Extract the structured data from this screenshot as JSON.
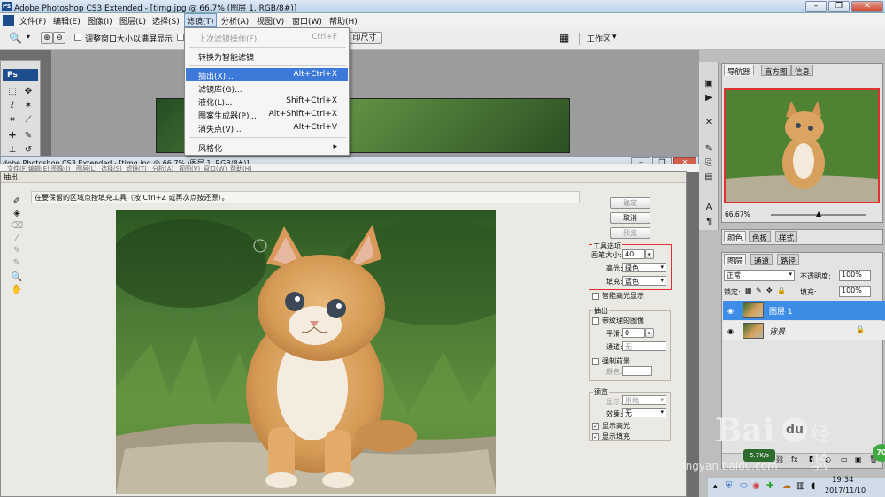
{
  "window": {
    "title": "Adobe Photoshop CS3 Extended - [timg.jpg @ 66.7% (图层 1, RGB/8#)]",
    "ps_badge": "Ps"
  },
  "window_controls": {
    "minimize": "–",
    "restore": "❐",
    "close": "✕"
  },
  "menubar": {
    "items": [
      "文件(F)",
      "编辑(E)",
      "图像(I)",
      "图层(L)",
      "选择(S)",
      "滤镜(T)",
      "分析(A)",
      "视图(V)",
      "窗口(W)",
      "帮助(H)"
    ],
    "active_index": 5
  },
  "options_bar": {
    "resize_window_label": "调整窗口大小以满屏显示",
    "print_size_button": "印尺寸",
    "workspace_label": "工作区"
  },
  "filter_menu": {
    "items": [
      {
        "label": "上次滤镜操作(F)",
        "shortcut": "Ctrl+F",
        "state": "disabled"
      },
      {
        "label": "转换为智能滤镜",
        "shortcut": "",
        "state": "normal"
      },
      {
        "label": "抽出(X)...",
        "shortcut": "Alt+Ctrl+X",
        "state": "highlighted"
      },
      {
        "label": "滤镜库(G)...",
        "shortcut": "",
        "state": "normal"
      },
      {
        "label": "液化(L)...",
        "shortcut": "Shift+Ctrl+X",
        "state": "normal"
      },
      {
        "label": "图案生成器(P)...",
        "shortcut": "Alt+Shift+Ctrl+X",
        "state": "normal"
      },
      {
        "label": "消失点(V)...",
        "shortcut": "Alt+Ctrl+V",
        "state": "normal"
      },
      {
        "label": "风格化",
        "shortcut": "",
        "state": "submenu"
      }
    ]
  },
  "toolbox": {
    "badge": "Ps"
  },
  "background_window": {
    "title": "dobe Photoshop CS3 Extended - [timg.jpg @ 66.7% (图层 1, RGB/8#)]",
    "menu_items": [
      "文件(F)",
      "编辑(E)",
      "图像(I)",
      "图层(L)",
      "选择(S)",
      "滤镜(T)",
      "分析(A)",
      "视图(V)",
      "窗口(W)",
      "帮助(H)"
    ]
  },
  "extract_dialog": {
    "title": "抽出",
    "hint": "在要保留的区域点按填充工具（按 Ctrl+Z 或再次点按还原）。",
    "buttons": {
      "ok": "确定",
      "cancel": "取消",
      "preview": "预览"
    },
    "tool_options": {
      "header": "工具选项",
      "brush_size_label": "画笔大小:",
      "brush_size_value": "40",
      "highlight_label": "高光:",
      "highlight_value": "绿色",
      "fill_label": "填充:",
      "fill_value": "蓝色",
      "smart_highlight": "智能高光显示"
    },
    "extraction": {
      "header": "抽出",
      "textured_image": "带纹理的图像",
      "smooth_label": "平滑:",
      "smooth_value": "0",
      "channel_label": "通道:",
      "channel_value": "无",
      "force_foreground": "强制前景",
      "color_label": "颜色:"
    },
    "preview": {
      "header": "预览",
      "show_label": "显示:",
      "show_value": "原稿",
      "effect_label": "效果:",
      "effect_value": "无",
      "show_highlight": "显示高光",
      "show_fill": "显示填充"
    }
  },
  "navigator_panel": {
    "tabs": [
      "导航器",
      "直方图",
      "信息"
    ],
    "zoom": "66.67%"
  },
  "color_panel": {
    "tabs": [
      "颜色",
      "色板",
      "样式"
    ]
  },
  "layers_panel": {
    "tabs": [
      "图层",
      "通道",
      "路径"
    ],
    "blend_mode": "正常",
    "opacity_label": "不透明度:",
    "opacity_value": "100%",
    "lock_label": "锁定:",
    "fill_label": "填充:",
    "fill_value": "100%",
    "layers": [
      {
        "name": "图层 1",
        "selected": true
      },
      {
        "name": "背景",
        "selected": false
      }
    ]
  },
  "watermark": {
    "brand": "Bai",
    "site": "jingyan.baidu.com",
    "label": "经验"
  },
  "network_widget": {
    "speed": "5.7K/s",
    "percent": "70"
  },
  "tray": {
    "time": "19:34",
    "date": "2017/11/10"
  },
  "colors": {
    "highlight": "#3d79d9",
    "red_box": "#e03030"
  }
}
